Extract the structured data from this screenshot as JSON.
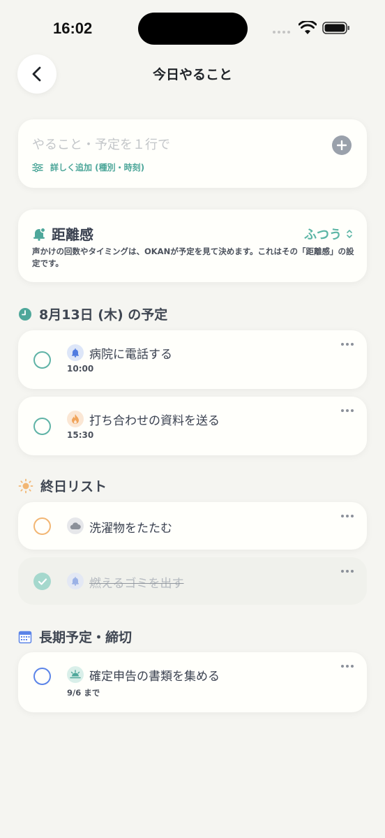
{
  "status": {
    "time": "16:02"
  },
  "header": {
    "title": "今日やること"
  },
  "input": {
    "placeholder": "やること・予定を１行で",
    "detail_label": "詳しく追加 (種別・時刻)"
  },
  "distance": {
    "title": "距離感",
    "value": "ふつう",
    "description": "声かけの回数やタイミングは、OKANが予定を見て決めます。これはその「距離感」の設定です。"
  },
  "sections": {
    "schedule": {
      "title": "8月13日 (木) の予定",
      "tasks": [
        {
          "title": "病院に電話する",
          "time": "10:00",
          "icon": "bell-icon",
          "done": false
        },
        {
          "title": "打ち合わせの資料を送る",
          "time": "15:30",
          "icon": "flame-icon",
          "done": false
        }
      ]
    },
    "allday": {
      "title": "終日リスト",
      "tasks": [
        {
          "title": "洗濯物をたたむ",
          "icon": "cloud-icon",
          "done": false
        },
        {
          "title": "燃えるゴミを出す",
          "icon": "bell-icon",
          "done": true
        }
      ]
    },
    "longterm": {
      "title": "長期予定・締切",
      "tasks": [
        {
          "title": "確定申告の書類を集める",
          "due": "9/6 まで",
          "icon": "sunrise-icon",
          "done": false
        }
      ]
    }
  },
  "colors": {
    "accent": "#5bb5a5",
    "background": "#f5f5f1",
    "card": "#fffffb",
    "orange": "#f2b673",
    "blue": "#5b84e8"
  }
}
